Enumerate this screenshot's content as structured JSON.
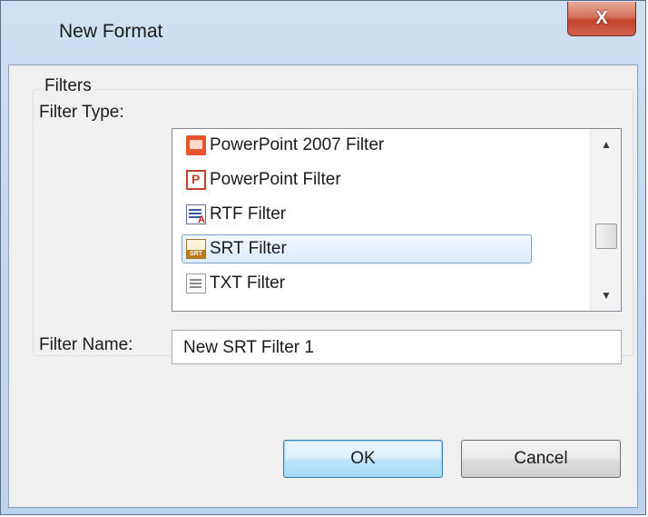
{
  "window": {
    "title": "New Format",
    "close_glyph": "X"
  },
  "group": {
    "legend": "Filters"
  },
  "filter_type": {
    "label": "Filter Type:",
    "items": [
      {
        "label": "PowerPoint 2007 Filter",
        "icon": "powerpoint-2007-icon",
        "selected": false
      },
      {
        "label": "PowerPoint Filter",
        "icon": "powerpoint-icon",
        "selected": false
      },
      {
        "label": "RTF Filter",
        "icon": "rtf-icon",
        "selected": false
      },
      {
        "label": "SRT Filter",
        "icon": "srt-icon",
        "selected": true
      },
      {
        "label": "TXT Filter",
        "icon": "txt-icon",
        "selected": false
      }
    ],
    "scroll_up_glyph": "▲",
    "scroll_down_glyph": "▼"
  },
  "filter_name": {
    "label": "Filter Name:",
    "value": "New SRT Filter 1"
  },
  "buttons": {
    "ok": "OK",
    "cancel": "Cancel"
  },
  "colors": {
    "titlebar": "#c2d7ee",
    "close": "#c2432a",
    "selection": "#dcebfc",
    "default_button": "#bee6fd"
  }
}
